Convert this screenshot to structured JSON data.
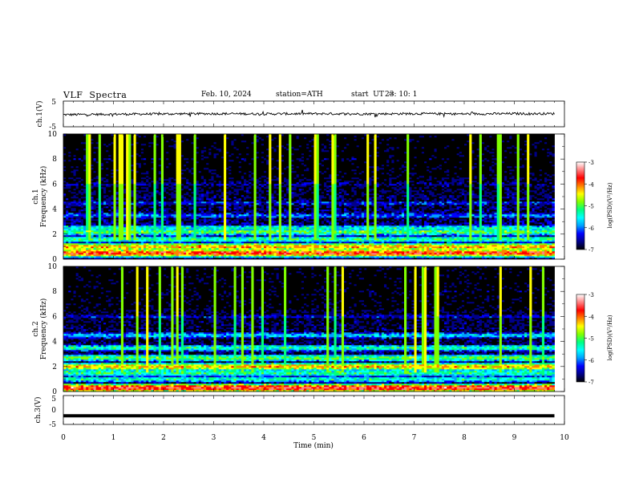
{
  "header": {
    "title": "VLF  Spectra",
    "date": "Feb. 10, 2024",
    "station": "station=ATH",
    "start_label": "start  UT  =",
    "start_value": "23: 10: 1"
  },
  "colors": {
    "background": "#ffffff",
    "axis": "#000000",
    "waveform": "#000000"
  },
  "chart_data": [
    {
      "type": "line",
      "panel": "ch1-waveform",
      "ylabel": "ch.1(V)",
      "ylim": [
        -5,
        5
      ],
      "yticks": [
        "5",
        "-5"
      ],
      "xlim": [
        0,
        10
      ],
      "series": [
        {
          "x": [
            0,
            1,
            2,
            3,
            4,
            5,
            6,
            7,
            8,
            9,
            9.8
          ],
          "values": [
            -0.3,
            -0.1,
            0.0,
            0.1,
            0.0,
            0.1,
            0.0,
            0.1,
            0.0,
            0.1,
            0.1
          ]
        }
      ]
    },
    {
      "type": "heatmap",
      "panel": "ch1-spectrogram",
      "ylabel_line1": "ch.1",
      "ylabel_line2": "Frequency  (kHz)",
      "ylim": [
        0,
        10
      ],
      "yticks": [
        "0",
        "2",
        "4",
        "6",
        "8",
        "10"
      ],
      "xlim": [
        0,
        10
      ],
      "colorbar": {
        "label": "log(PSD)(V²/Hz)",
        "range": [
          -7,
          -3
        ],
        "ticks": [
          "-3",
          "-4",
          "-5",
          "-6",
          "-7"
        ],
        "colormap": [
          "#000000",
          "#00008a",
          "#0000ff",
          "#00a0ff",
          "#00ffff",
          "#00ff80",
          "#80ff00",
          "#ffff00",
          "#ff8000",
          "#ff0000",
          "#ff8080",
          "#ffffff"
        ]
      },
      "bands_khz": [
        {
          "freq": 0.5,
          "level": -3.8
        },
        {
          "freq": 1.0,
          "level": -4.2
        },
        {
          "freq": 1.6,
          "level": -5.2
        },
        {
          "freq": 2.2,
          "level": -5.0
        },
        {
          "freq": 2.5,
          "level": -5.4
        },
        {
          "freq": 3.5,
          "level": -6.0
        },
        {
          "freq": 4.5,
          "level": -6.3
        },
        {
          "freq": 6.0,
          "level": -6.6
        },
        {
          "freq": 8.0,
          "level": -6.8
        }
      ]
    },
    {
      "type": "heatmap",
      "panel": "ch2-spectrogram",
      "ylabel_line1": "ch.2",
      "ylabel_line2": "Frequency  (kHz)",
      "ylim": [
        0,
        10
      ],
      "yticks": [
        "0",
        "2",
        "4",
        "6",
        "8",
        "10"
      ],
      "xlim": [
        0,
        10
      ],
      "colorbar": {
        "label": "log(PSD)(V²/Hz)",
        "range": [
          -7,
          -3
        ],
        "ticks": [
          "-3",
          "-4",
          "-5",
          "-6",
          "-7"
        ],
        "colormap": [
          "#000000",
          "#00008a",
          "#0000ff",
          "#00a0ff",
          "#00ffff",
          "#00ff80",
          "#80ff00",
          "#ffff00",
          "#ff8000",
          "#ff0000",
          "#ff8080",
          "#ffffff"
        ]
      },
      "bands_khz": [
        {
          "freq": 0.3,
          "level": -3.6
        },
        {
          "freq": 1.0,
          "level": -5.4
        },
        {
          "freq": 1.5,
          "level": -5.2
        },
        {
          "freq": 2.0,
          "level": -4.3
        },
        {
          "freq": 2.7,
          "level": -5.0
        },
        {
          "freq": 3.5,
          "level": -5.3
        },
        {
          "freq": 4.5,
          "level": -5.7
        },
        {
          "freq": 6.0,
          "level": -6.4
        },
        {
          "freq": 8.0,
          "level": -6.8
        }
      ]
    },
    {
      "type": "line",
      "panel": "ch3-waveform",
      "ylabel": "ch.3(V)",
      "ylim": [
        -5,
        5
      ],
      "yticks": [
        "5",
        "0",
        "-5"
      ],
      "xlabel": "Time  (min)",
      "xlim": [
        0,
        10
      ],
      "xticks": [
        "0",
        "1",
        "2",
        "3",
        "4",
        "5",
        "6",
        "7",
        "8",
        "9",
        "10"
      ],
      "series": [
        {
          "x": [
            0,
            9.8
          ],
          "values": [
            -2,
            -2
          ]
        }
      ]
    }
  ]
}
